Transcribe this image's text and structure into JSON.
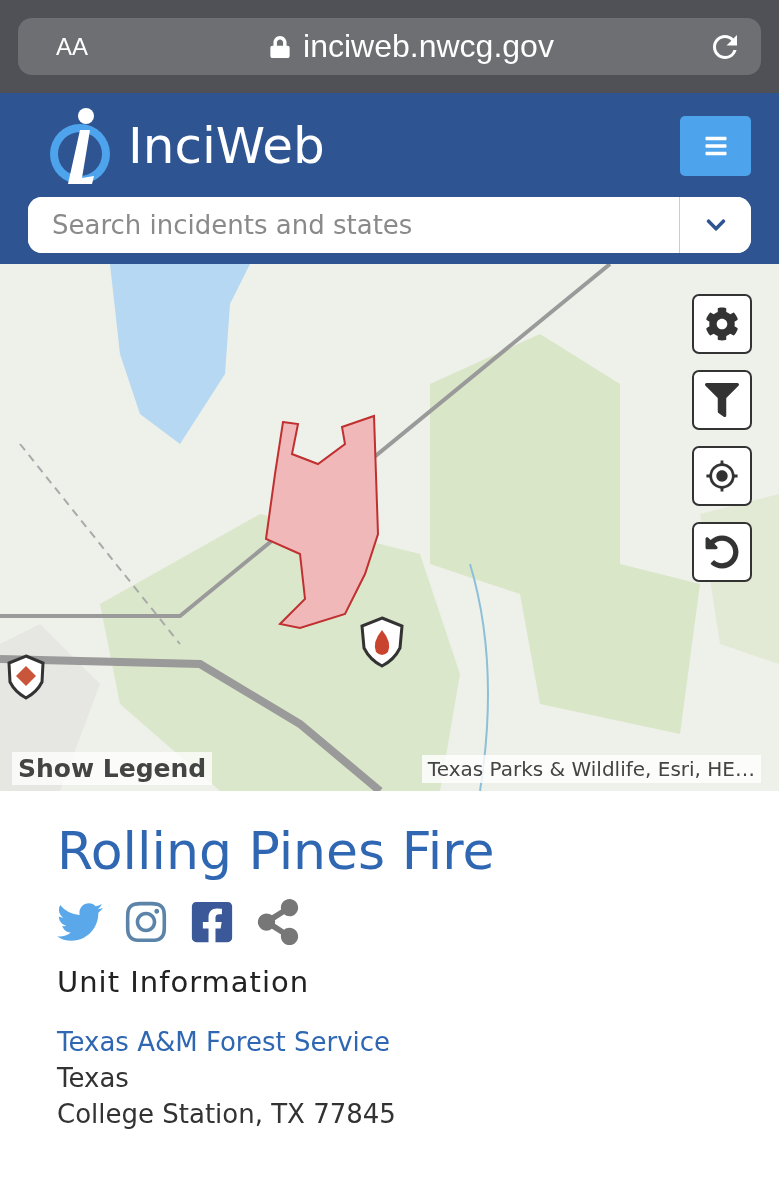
{
  "browser": {
    "text_size": "AA",
    "url": "inciweb.nwcg.gov"
  },
  "header": {
    "site_name": "InciWeb",
    "search": {
      "placeholder": "Search incidents and states"
    }
  },
  "map": {
    "legend_button": "Show Legend",
    "attribution": "Texas Parks & Wildlife, Esri, HE…"
  },
  "incident": {
    "title": "Rolling Pines Fire",
    "unit_heading": "Unit Information",
    "unit_link": "Texas A&M Forest Service",
    "address_lines": [
      "Texas",
      "College Station, TX 77845"
    ]
  }
}
